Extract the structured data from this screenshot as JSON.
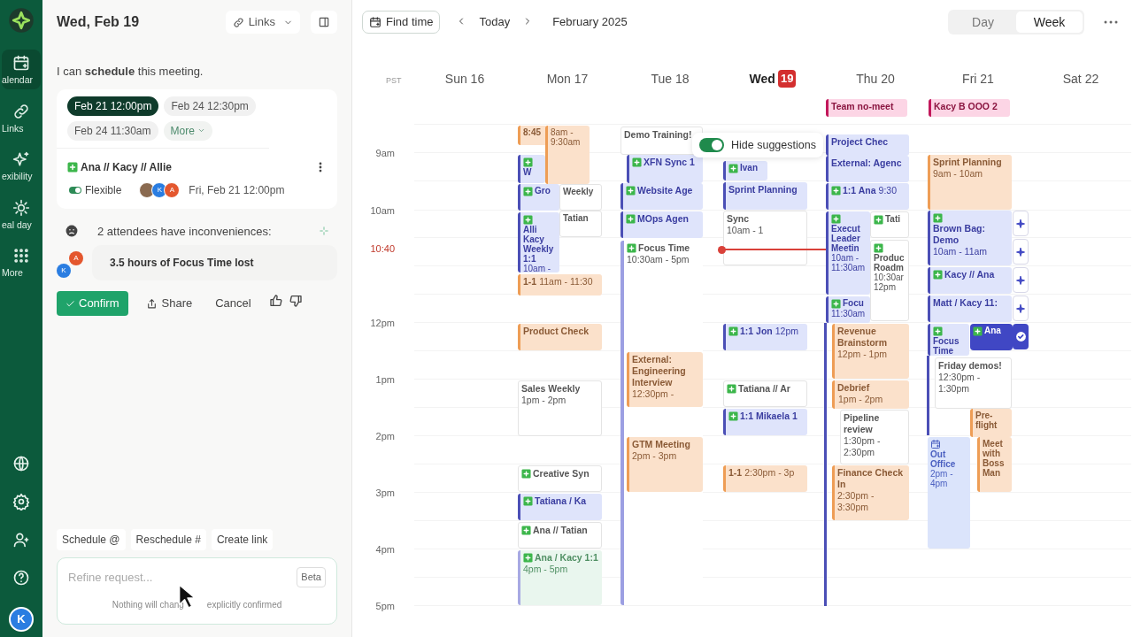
{
  "sidebar": {
    "items": [
      {
        "label": "alendar",
        "selected": true
      },
      {
        "label": "Links",
        "selected": false
      },
      {
        "label": "exibility",
        "selected": false
      },
      {
        "label": "eal day",
        "selected": false
      },
      {
        "label": "More",
        "selected": false
      }
    ],
    "avatar": "K"
  },
  "panel": {
    "title": "Wed, Feb 19",
    "links_button": "Links",
    "message": "I can **schedule** this meeting.",
    "slots": [
      {
        "label": "Feb 21 12:00pm",
        "selected": true
      },
      {
        "label": "Feb 24 12:30pm",
        "selected": false
      },
      {
        "label": "Feb 24 11:30am",
        "selected": false
      }
    ],
    "more_button": "More",
    "event": {
      "title": "Ana // Kacy // Allie",
      "flexible": {
        "label": "Flexible",
        "on": true
      },
      "avatars": [
        {
          "kind": "photo"
        },
        {
          "kind": "initial",
          "text": "K",
          "color": "#2a7de1"
        },
        {
          "kind": "initial",
          "text": "A",
          "color": "#e4572e"
        }
      ],
      "when": "Fri, Feb 21 12:00pm"
    },
    "inconvenience": "2 attendees have inconveniences:",
    "issue_avatars": [
      {
        "text": "A",
        "color": "#e4572e"
      },
      {
        "text": "K",
        "color": "#2a7de1"
      }
    ],
    "issue": "3.5 hours of Focus Time lost",
    "actions": {
      "confirm": "Confirm",
      "share": "Share",
      "cancel": "Cancel"
    },
    "shortcuts": [
      "Schedule @",
      "Reschedule #",
      "Create link"
    ],
    "input": {
      "placeholder": "Refine request...",
      "badge": "Beta",
      "note_start": "Nothing will chang",
      "note_end": "explicitly confirmed"
    }
  },
  "toolbar": {
    "find_time": "Find time",
    "today": "Today",
    "month": "February 2025",
    "views": [
      {
        "label": "Day",
        "selected": false
      },
      {
        "label": "Week",
        "selected": true
      }
    ]
  },
  "calendar": {
    "timezone": "PST",
    "days": [
      {
        "name": "Sun",
        "date": "16",
        "today": false
      },
      {
        "name": "Mon",
        "date": "17",
        "today": false
      },
      {
        "name": "Tue",
        "date": "18",
        "today": false
      },
      {
        "name": "Wed",
        "date": "19",
        "today": true
      },
      {
        "name": "Thu",
        "date": "20",
        "today": false
      },
      {
        "name": "Fri",
        "date": "21",
        "today": false
      },
      {
        "name": "Sat",
        "date": "22",
        "today": false
      }
    ],
    "hours": [
      "9am",
      "10am",
      "12pm",
      "1pm",
      "2pm",
      "3pm",
      "4pm",
      "5pm"
    ],
    "now": "10:40",
    "suggestions_toggle": {
      "label": "Hide suggestions",
      "on": true
    },
    "events": [
      {
        "title": "Team no-meet",
        "kind": "allday",
        "added": false
      },
      {
        "title": "Kacy B OOO 2",
        "kind": "allday",
        "added": false
      },
      {
        "title": "8:45",
        "kind": "personal",
        "added": false
      },
      {
        "title": "W",
        "kind": "meeting",
        "added": true
      },
      {
        "time": "8am - 9:30am",
        "kind": "personal",
        "added": false
      },
      {
        "title": "Gro",
        "kind": "meeting",
        "added": true
      },
      {
        "title": "Weekly",
        "kind": "invite",
        "added": false
      },
      {
        "title": "Alli Kacy Weekly 1:1",
        "time": "10am -",
        "kind": "meeting",
        "added": true
      },
      {
        "title": "Tatian",
        "kind": "invite",
        "added": false
      },
      {
        "title": "1-1",
        "time": "11am - 11:30",
        "kind": "personal",
        "added": false
      },
      {
        "title": "Product Check",
        "kind": "personal",
        "added": false
      },
      {
        "title": "Sales Weekly",
        "time": "1pm - 2pm",
        "kind": "invite",
        "added": false
      },
      {
        "title": "Creative Syn",
        "kind": "invite",
        "added": true
      },
      {
        "title": "Tatiana / Ka",
        "kind": "meeting",
        "added": true
      },
      {
        "title": "Ana // Tatian",
        "kind": "invite",
        "added": true
      },
      {
        "title": "Ana / Kacy 1:1",
        "time": "4pm - 5pm",
        "kind": "focus",
        "added": true
      },
      {
        "title": "Demo Training!",
        "kind": "invite",
        "added": false
      },
      {
        "title": "XFN Sync 1",
        "kind": "meeting",
        "added": true
      },
      {
        "title": "Website Age",
        "kind": "meeting",
        "added": true
      },
      {
        "title": "MOps Agen",
        "kind": "meeting",
        "added": true
      },
      {
        "title": "Focus Time",
        "time": "10:30am - 5pm",
        "kind": "block",
        "added": true
      },
      {
        "title": "External: Engineering Interview",
        "time": "12:30pm -",
        "kind": "personal",
        "added": false
      },
      {
        "title": "GTM Meeting",
        "time": "2pm - 3pm",
        "kind": "personal",
        "added": false
      },
      {
        "title": "Ivan",
        "kind": "meeting",
        "added": true
      },
      {
        "title": "Sprint Planning",
        "kind": "meeting",
        "added": false
      },
      {
        "title": "Sync",
        "time": "10am - 1",
        "kind": "invite",
        "added": false
      },
      {
        "title": "1:1 Jon",
        "time": "12pm",
        "kind": "meeting",
        "added": true
      },
      {
        "title": "Tatiana // Ar",
        "kind": "invite",
        "added": true
      },
      {
        "title": "1:1 Mikaela 1",
        "kind": "meeting",
        "added": true
      },
      {
        "title": "1-1",
        "time": "2:30pm - 3p",
        "kind": "personal",
        "added": false
      },
      {
        "title": "Project Chec",
        "kind": "meeting",
        "added": false
      },
      {
        "title": "External: Agenc",
        "kind": "meeting",
        "added": false
      },
      {
        "title": "1:1 Ana",
        "time": "9:30",
        "kind": "meeting",
        "added": true
      },
      {
        "title": "Execut Leader Meetin",
        "time": "10am - 11:30am",
        "kind": "meeting",
        "added": true
      },
      {
        "title": "Focu",
        "time": "11:30am",
        "kind": "meeting",
        "added": true
      },
      {
        "title": "Tati",
        "kind": "invite",
        "added": true
      },
      {
        "title": "Produc Roadm",
        "time": "10:30ar 12pm",
        "kind": "invite",
        "added": true
      },
      {
        "title": "Revenue Brainstorm",
        "time": "12pm - 1pm",
        "kind": "personal",
        "added": false
      },
      {
        "title": "Debrief",
        "time": "1pm - 2pm",
        "kind": "personal",
        "added": false
      },
      {
        "title": "Pipeline review",
        "time": "1:30pm - 2:30pm",
        "kind": "invite",
        "added": false
      },
      {
        "title": "Finance Check In",
        "time": "2:30pm - 3:30pm",
        "kind": "personal",
        "added": false
      },
      {
        "title": "Sprint Planning",
        "time": "9am - 10am",
        "kind": "personal",
        "added": false
      },
      {
        "title": "Brown Bag: Demo",
        "time": "10am - 11am",
        "kind": "meeting",
        "added": true
      },
      {
        "title": "Kacy // Ana",
        "kind": "meeting",
        "added": true
      },
      {
        "title": "Matt / Kacy 11:",
        "kind": "meeting",
        "added": false
      },
      {
        "title": "Focus Time",
        "kind": "meeting",
        "added": true
      },
      {
        "title": "Ana",
        "kind": "suggestion",
        "added": true
      },
      {
        "title": "Friday demos!",
        "time": "12:30pm - 1:30pm",
        "kind": "invite",
        "added": false
      },
      {
        "title": "Out Office",
        "time": "2pm - 4pm",
        "kind": "away",
        "added": false
      },
      {
        "title": "Pre-flight",
        "kind": "personal",
        "added": false
      },
      {
        "title": "Meet with Boss Man",
        "kind": "personal",
        "added": false
      }
    ],
    "suggestion_buttons": [
      {
        "kind": "add"
      },
      {
        "kind": "add"
      },
      {
        "kind": "add"
      },
      {
        "kind": "add"
      },
      {
        "kind": "confirmed"
      }
    ]
  }
}
